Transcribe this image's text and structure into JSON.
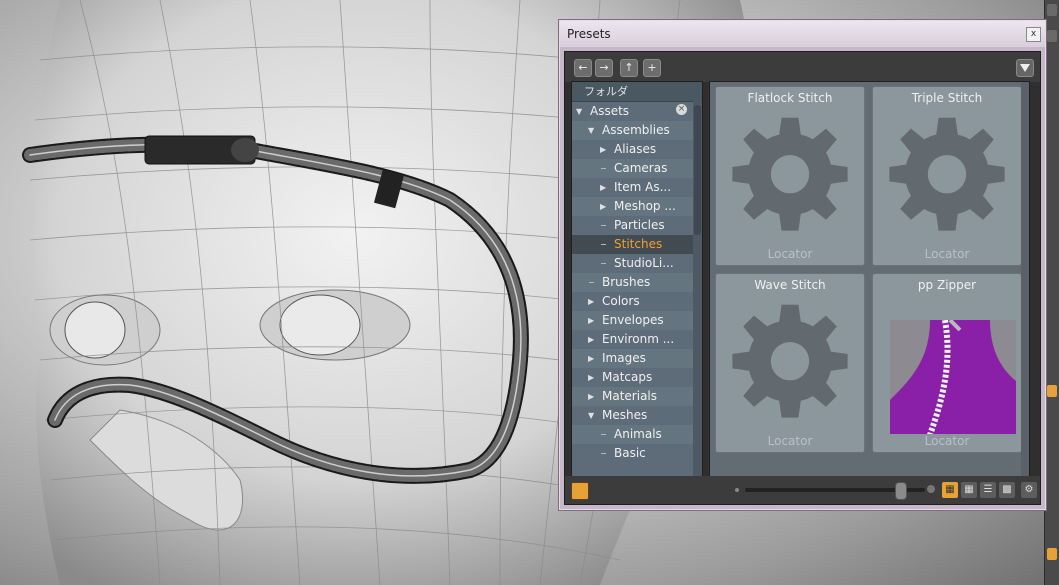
{
  "panel": {
    "title": "Presets",
    "close_label": "x"
  },
  "toolbar": {
    "back_icon": "arrow-left-icon",
    "forward_icon": "arrow-right-icon",
    "up_icon": "folder-up-icon",
    "add_icon": "plus-icon",
    "filter_icon": "filter-icon"
  },
  "tree": {
    "header": "フォルダ",
    "items": [
      {
        "label": "Assets",
        "type": "expanded"
      },
      {
        "label": "Assemblies",
        "type": "expanded"
      },
      {
        "label": "Aliases",
        "type": "collapsed"
      },
      {
        "label": "Cameras",
        "type": "leaf"
      },
      {
        "label": "Item As...",
        "type": "collapsed"
      },
      {
        "label": "Meshop ...",
        "type": "collapsed"
      },
      {
        "label": "Particles",
        "type": "leaf"
      },
      {
        "label": "Stitches",
        "type": "leaf",
        "selected": true
      },
      {
        "label": "StudioLi...",
        "type": "leaf"
      },
      {
        "label": "Brushes",
        "type": "leaf"
      },
      {
        "label": "Colors",
        "type": "collapsed"
      },
      {
        "label": "Envelopes",
        "type": "collapsed"
      },
      {
        "label": "Environm ...",
        "type": "collapsed"
      },
      {
        "label": "Images",
        "type": "collapsed"
      },
      {
        "label": "Matcaps",
        "type": "collapsed"
      },
      {
        "label": "Materials",
        "type": "collapsed"
      },
      {
        "label": "Meshes",
        "type": "expanded"
      },
      {
        "label": "Animals",
        "type": "leaf"
      },
      {
        "label": "Basic",
        "type": "leaf"
      }
    ]
  },
  "presets": [
    {
      "title": "Flatlock Stitch",
      "type": "Locator",
      "thumbnail": "gear-icon"
    },
    {
      "title": "Triple Stitch",
      "type": "Locator",
      "thumbnail": "gear-icon"
    },
    {
      "title": "Wave Stitch",
      "type": "Locator",
      "thumbnail": "gear-icon"
    },
    {
      "title": "pp Zipper",
      "type": "Locator",
      "thumbnail": "zipper-image"
    }
  ],
  "colors": {
    "accent": "#e6a236",
    "selected_text": "#f0a030",
    "tree_bg": "#5d6c78",
    "tile_bg": "#8c969d"
  }
}
